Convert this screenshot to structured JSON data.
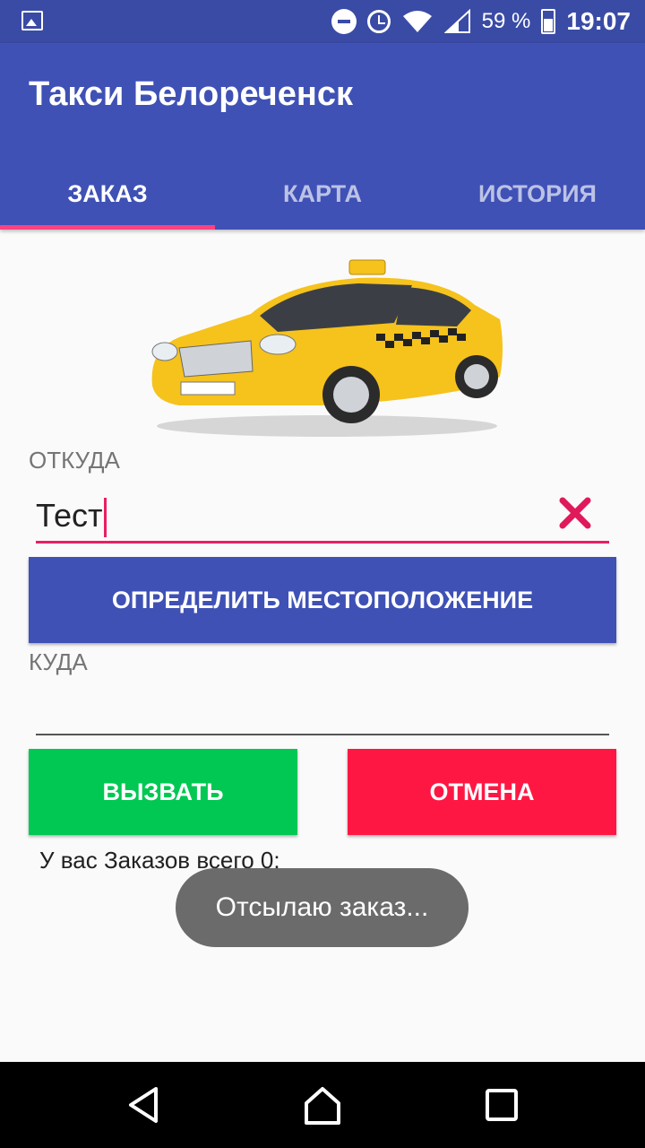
{
  "status_bar": {
    "icons": [
      "gallery-icon",
      "do-not-disturb-icon",
      "alarm-icon",
      "wifi-icon",
      "signal-icon",
      "battery-icon"
    ],
    "battery": "59 %",
    "time": "19:07"
  },
  "app": {
    "title": "Такси Белореченск",
    "colors": {
      "primary": "#3f51b5",
      "accent": "#ff4081",
      "call": "#00c853",
      "cancel": "#ff1744"
    }
  },
  "tabs": [
    {
      "label": "ЗАКАЗ",
      "active": true
    },
    {
      "label": "КАРТА",
      "active": false
    },
    {
      "label": "ИСТОРИЯ",
      "active": false
    }
  ],
  "form": {
    "from_label": "ОТКУДА",
    "from_value": "Тест",
    "locate_button": "ОПРЕДЕЛИТЬ МЕСТОПОЛОЖЕНИЕ",
    "to_label": "КУДА",
    "to_value": "",
    "call_button": "ВЫЗВАТЬ",
    "cancel_button": "ОТМЕНА"
  },
  "orders_text": "У вас Заказов всего 0:",
  "toast": "Отсылаю заказ...",
  "nav": {
    "icons": [
      "back-icon",
      "home-icon",
      "recent-apps-icon"
    ]
  }
}
